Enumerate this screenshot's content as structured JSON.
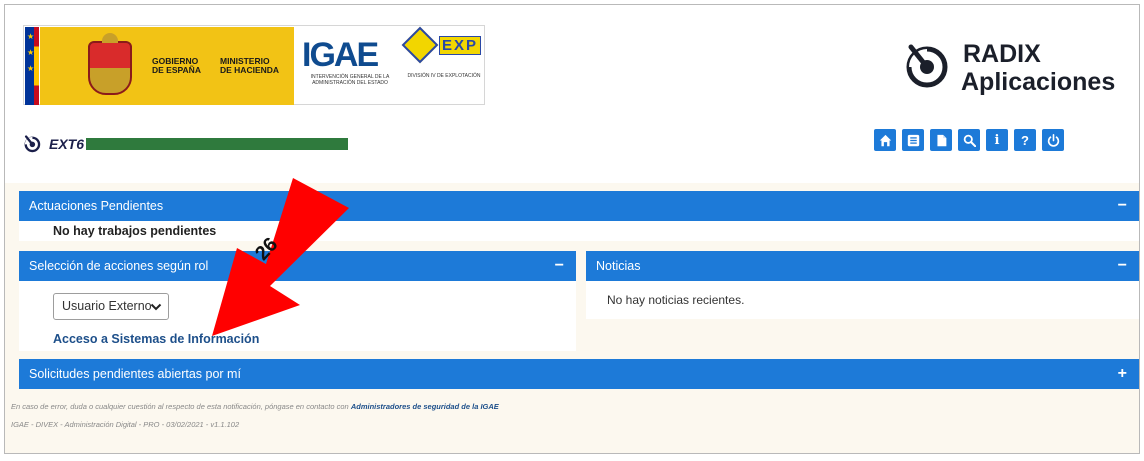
{
  "banner": {
    "gov_line1": "GOBIERNO",
    "gov_line2": "DE ESPAÑA",
    "ministry_line1": "MINISTERIO",
    "ministry_line2": "DE HACIENDA",
    "igae_logo": "IGAE",
    "igae_sub": "INTERVENCIÓN GENERAL DE LA ADMINISTRACIÓN DEL ESTADO",
    "divex_logo": "EXP",
    "divex_sub": "DIVISIÓN IV DE EXPLOTACIÓN"
  },
  "radix": {
    "title1": "RADIX",
    "title2": "Aplicaciones",
    "icon": "radix-logo-icon"
  },
  "user": {
    "code": "EXT6",
    "icon": "radix-small-icon"
  },
  "toolbar": {
    "buttons": [
      {
        "name": "home-icon",
        "glyph": "home"
      },
      {
        "name": "list-icon",
        "glyph": "list"
      },
      {
        "name": "document-icon",
        "glyph": "document"
      },
      {
        "name": "search-icon",
        "glyph": "search"
      },
      {
        "name": "info-icon",
        "glyph": "i"
      },
      {
        "name": "help-icon",
        "glyph": "?"
      },
      {
        "name": "power-icon",
        "glyph": "power"
      }
    ]
  },
  "panels": {
    "pending": {
      "title": "Actuaciones Pendientes",
      "control": "−",
      "message": "No hay trabajos pendientes"
    },
    "roles": {
      "title": "Selección de acciones según rol",
      "control": "−",
      "select_value": "Usuario Externo",
      "link": "Acceso a Sistemas de Información"
    },
    "news": {
      "title": "Noticias",
      "control": "−",
      "message": "No hay noticias recientes."
    },
    "requests": {
      "title": "Solicitudes pendientes abiertas por mí",
      "control": "+"
    }
  },
  "footer": {
    "contact_text": "En caso de error, duda o cualquier cuestión al respecto de esta notificación, póngase en contacto con",
    "contact_link": "Administradores de seguridad de la IGAE",
    "version": "IGAE - DIVEX - Administración Digital - PRO - 03/02/2021 - v1.1.102"
  },
  "annotation": {
    "number": "26",
    "color": "#ff0000"
  },
  "colors": {
    "accent": "#1d7ad8",
    "background": "#fcf8ef",
    "link": "#1d4f8a"
  }
}
